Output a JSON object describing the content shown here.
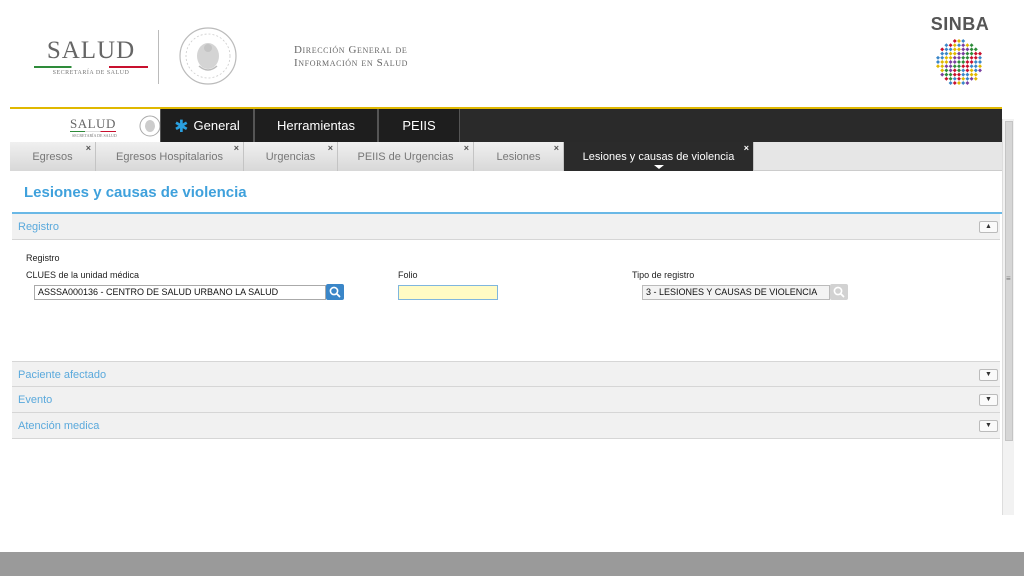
{
  "header": {
    "salud_logo_text": "SALUD",
    "salud_logo_subtitle": "SECRETARÍA DE SALUD",
    "dgis_line1": "Dirección General de",
    "dgis_line2": "Información en Salud",
    "sinba_logo_text": "SINBA"
  },
  "navbar": {
    "items": [
      {
        "label": "General",
        "icon": "asterisk-icon"
      },
      {
        "label": "Herramientas"
      },
      {
        "label": "PEIIS"
      }
    ]
  },
  "tabs": [
    {
      "label": "Egresos",
      "active": false
    },
    {
      "label": "Egresos Hospitalarios",
      "active": false
    },
    {
      "label": "Urgencias",
      "active": false
    },
    {
      "label": "PEIIS de Urgencias",
      "active": false
    },
    {
      "label": "Lesiones",
      "active": false
    },
    {
      "label": "Lesiones y causas de violencia",
      "active": true
    }
  ],
  "tab_close_glyph": "×",
  "page_title": "Lesiones y causas de violencia",
  "sections": {
    "registro": {
      "label": "Registro",
      "expanded": true,
      "group_label": "Registro",
      "clues": {
        "label": "CLUES de la unidad médica",
        "value": "ASSSA000136 - CENTRO DE SALUD URBANO LA SALUD"
      },
      "folio": {
        "label": "Folio",
        "value": ""
      },
      "tipo": {
        "label": "Tipo de registro",
        "value": "3 - LESIONES Y CAUSAS DE VIOLENCIA"
      }
    },
    "paciente": {
      "label": "Paciente afectado",
      "expanded": false
    },
    "evento": {
      "label": "Evento",
      "expanded": false
    },
    "atencion": {
      "label": "Atención medica",
      "expanded": false
    }
  },
  "toggle_glyphs": {
    "up": "▲",
    "down": "▼"
  },
  "colors": {
    "accent_blue": "#3fa1dc",
    "navbar_bg": "#2a2a2a",
    "gold": "#e0b800",
    "folio_highlight": "#fffbc4",
    "search_button": "#3a86c8"
  }
}
